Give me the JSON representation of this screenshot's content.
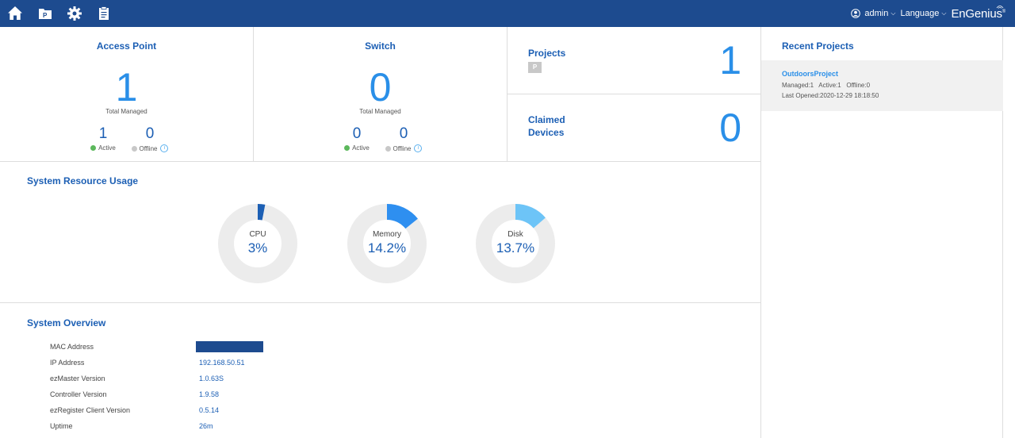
{
  "nav": {
    "icons": [
      "home-icon",
      "project-icon",
      "gear-icon",
      "clipboard-icon"
    ],
    "user_label": "admin",
    "language_label": "Language",
    "brand": "EnGenius",
    "brand_mark": "®",
    "brand_color": "#1d4b8f"
  },
  "access_point": {
    "title": "Access Point",
    "total": "1",
    "total_label": "Total Managed",
    "active": "1",
    "active_label": "Active",
    "offline": "0",
    "offline_label": "Offline"
  },
  "switch": {
    "title": "Switch",
    "total": "0",
    "total_label": "Total Managed",
    "active": "0",
    "active_label": "Active",
    "offline": "0",
    "offline_label": "Offline"
  },
  "projects": {
    "title": "Projects",
    "count": "1",
    "badge": "P"
  },
  "claimed": {
    "title_line1": "Claimed",
    "title_line2": "Devices",
    "count": "0"
  },
  "resources": {
    "title": "System Resource Usage",
    "items": [
      {
        "label": "CPU",
        "value_text": "3%",
        "value": 3,
        "color": "#1c5fb4"
      },
      {
        "label": "Memory",
        "value_text": "14.2%",
        "value": 14.2,
        "color": "#2e8ff0"
      },
      {
        "label": "Disk",
        "value_text": "13.7%",
        "value": 13.7,
        "color": "#6dc4f7"
      }
    ]
  },
  "overview": {
    "title": "System Overview",
    "rows": [
      {
        "key": "MAC Address",
        "value": ""
      },
      {
        "key": "IP Address",
        "value": "192.168.50.51"
      },
      {
        "key": "ezMaster Version",
        "value": "1.0.63S"
      },
      {
        "key": "Controller Version",
        "value": "1.9.58"
      },
      {
        "key": "ezRegister Client Version",
        "value": "0.5.14"
      },
      {
        "key": "Uptime",
        "value": "26m"
      }
    ]
  },
  "recent": {
    "title": "Recent Projects",
    "items": [
      {
        "name": "OutdoorsProject",
        "meta": "Managed:1   Active:1   Offline:0",
        "opened": "Last Opened:2020-12-29 18:18:50"
      }
    ]
  },
  "colors": {
    "active": "#5cb85c",
    "offline": "#c8c8c8",
    "accent": "#1c5fb4",
    "number": "#2a8fe8"
  }
}
